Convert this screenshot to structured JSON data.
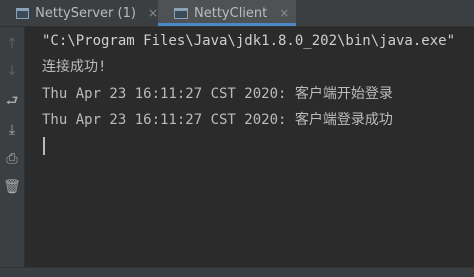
{
  "tabs": [
    {
      "label": "NettyServer (1)",
      "icon": "console-icon",
      "closable": true,
      "active": false
    },
    {
      "label": "NettyClient",
      "icon": "console-icon",
      "closable": true,
      "active": true
    }
  ],
  "tab_close_glyph": "×",
  "gutter": {
    "up_arrow": "↑",
    "down_arrow": "↓",
    "soft_wrap": "⮐",
    "scroll_to_end": "⤓",
    "print": "⎙",
    "trash": "🗑"
  },
  "console": {
    "lines": [
      "\"C:\\Program Files\\Java\\jdk1.8.0_202\\bin\\java.exe\"",
      "连接成功!",
      "Thu Apr 23 16:11:27 CST 2020: 客户端开始登录",
      "Thu Apr 23 16:11:27 CST 2020: 客户端登录成功"
    ]
  },
  "colors": {
    "background": "#2b2b2b",
    "tab_bar": "#3c3f41",
    "active_tab_accent": "#4a88c7",
    "text": "#bbbbbb"
  }
}
